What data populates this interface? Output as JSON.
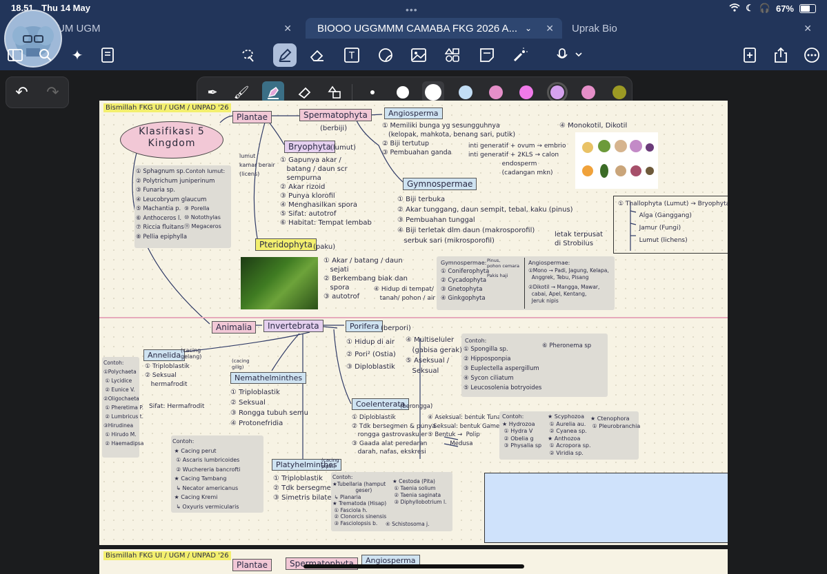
{
  "status": {
    "time": "18.51",
    "date": "Thu 14 May",
    "battery": "67%"
  },
  "tabs": [
    {
      "label": "UM UGM"
    },
    {
      "label": "BIOOO UGGMMM CAMABA FKG 2026 A..."
    },
    {
      "label": "Uprak Bio"
    }
  ],
  "toolbar": {
    "icons": [
      "sidebar-icon",
      "search-icon",
      "sparkle-icon",
      "export-pages-icon",
      "lasso-icon",
      "pen-icon",
      "eraser-icon",
      "textbox-icon",
      "sticker-icon",
      "image-icon",
      "shapes-icon",
      "note-icon",
      "laser-icon",
      "mic-icon",
      "add-page-icon",
      "share-icon",
      "more-icon"
    ]
  },
  "pen_tools": {
    "colors": [
      "#ffffff",
      "#ffffff",
      "#ffffff",
      "#c2ddf5",
      "#e58fc9",
      "#f07ae9",
      "#d6a2ef",
      "#e58fc9",
      "#9c9a24"
    ],
    "selected_color_index": 6
  },
  "note": {
    "header": "Bismillah FKG UI / UGM / UNPAD '26",
    "title": "Klasifikasi 5 Kingdom",
    "plantae": "Plantae",
    "spermatophyta": "Spermatophyta",
    "berbiji": "(berbiji)",
    "angiosperma": "Angiosperma",
    "angio_points": "① Memiliki bunga yg sesungguhnya\n   (kelopak, mahkota, benang sari, putik)\n② Biji tertutup\n③ Pembuahan ganda",
    "angio_fert": "inti generatif + ovum → embrio\ninti generatif + 2KLS → calon\n                 endosperm\n                 (cadangan mkn)",
    "monokotil": "④ Monokotil, Dikotil",
    "lumut_label": "lumut\nkamar berair\n(licens)",
    "bryophyta": "Bryophyta",
    "bryo_lumut": "(lumut)",
    "bryo_points": "① Gapunya akar /\n   batang / daun scr\n   sempurna\n② Akar rizoid\n③ Punya klorofil\n④ Menghasilkan spora\n⑤ Sifat: autotrof\n⑥ Habitat: Tempat lembab",
    "lumut_examples_title": "Contoh lumut:",
    "lumut_examples": "① Sphagnum sp.\n② Polytrichum juniperinum\n③ Funaria sp.\n④ Leucobryum glaucum\n⑤ Machantia p.\n⑥ Anthoceros l.\n⑦ Riccia fluitans\n⑧ Pellia epiphylla",
    "lumut_examples2": "⑨ Porella\n⑩ Notothylas\n⑪ Megaceros",
    "gymnospermae": "Gymnospermae",
    "gymno_points": "① Biji terbuka\n② Akar tunggang, daun sempit, tebal, kaku (pinus)\n③ Pembuahan tunggal\n④ Biji terletak dlm daun (makrosporofil)\n   serbuk sari (mikrosporofil)",
    "strobilus": "letak terpusat\ndi Strobilus",
    "gymno_box_title": "Gymnospermae:",
    "gymno_box": "① Coniferophyta\n② Cycadophyta\n③ Gnetophyta\n④ Ginkgophyta",
    "pinus": "Pinus,\npohon cemara",
    "pakis": "Pakis haji",
    "angio_box_title": "Angiospermae:",
    "angio_box_mono": "①Mono → Padi, Jagung, Kelapa,\n  Anggrek, Tebu, Pisang",
    "angio_box_di": "②Dikotil → Mangga, Mawar,\n  cabai, Apel, Kentang,\n  Jeruk nipis",
    "thallophyta": "① Thallophyta (Lumut) → Bryophyta",
    "thallo_items": "   Alga (Ganggang)\n   Jamur (Fungi)\n   Lumut (lichens)",
    "pteridophyta": "Pteridophyta",
    "paku": "(paku)",
    "pteri_points": "① Akar / batang / daun\n   sejati\n② Berkembang biak dan\n   spora\n③ autotrof",
    "pteri_4": "④ Hidup di tempat/\n   tanah/ pohon / air",
    "animalia": "Animalia",
    "invertebrata": "Invertebrata",
    "porifera": "Porifera",
    "porifera_note": "(berpori)",
    "porifera_points": "① Hidup di air\n② Pori² (Ostia)\n③ Diploblastik",
    "porifera_points2": "④ Multiseluler\n   (gabisa gerak)\n⑤ Aseksual /\n   Seksual",
    "porifera_ex_title": "Contoh:",
    "porifera_ex": "① Spongilla sp.\n② Hipposponpia\n③ Euplectella aspergillum\n④ Sycon ciliatum\n⑤ Leucosolenia botryoides",
    "porifera_ex2": "⑥ Pheronema sp",
    "annelida": "Annelida",
    "annelida_note": "(cacing\ngelang)",
    "annelida_points": "① Triploblastik\n② Seksual\n   hermafrodit",
    "annelida_ex": "Contoh:\n①Polychaeta\n ① Lycidice\n ② Eunice V.\n②Oligochaeta\n ① Pheretima P.\n ② Lumbricus t.\n③Hirudinea\n ① Hirudo M.\n ② Haemadipsa",
    "hermafrodit": "Sifat: Hermafrodit",
    "nemathelminthes": "Nemathelminthes",
    "nemat_note": "(cacing\ngilig)",
    "nemat_points": "① Triploblastik\n② Seksual\n③ Rongga tubuh semu\n④ Protonefridia",
    "nemat_ex": "Contoh:\n ★ Cacing perut\n  ① Ascaris lumbricoides\n  ② Wuchereria bancrofti\n ★ Cacing Tambang\n  ↳ Necator americanus\n ★ Cacing Kremi\n  ↳ Oxyuris vermicularis",
    "coelenterata": "Coelenterata",
    "coel_note": "(berongga)",
    "coel_points": "① Diploblastik\n② Tdk bersegmen & punya\n   rongga gastrovaskuler\n③ Gaada alat peredaran\n   darah, nafas, ekskresi",
    "coel_points2": "④ Aseksual: bentuk Tunas\n   Seksual: bentuk Gamet\n⑤ Bentuk →  Polip\n            Medusa",
    "coel_ex": "Contoh:\n★ Hydrozoa\n ① Hydra V\n ② Obelia g\n ③ Physalia sp",
    "coel_ex2": "★ Scyphozoa\n ① Aurelia au.\n ② Cyanea sp.\n★ Anthozoa\n ① Acropora sp.\n ② Viridia sp.",
    "coel_ex3": "★ Ctenophora\n ① Pleurobranchia",
    "platyhelminthes": "Platyhelminthes",
    "platy_note": "(cacing\npipih)",
    "platy_points": "① Triploblastik\n② Tdk bersegmen\n③ Simetris bilateral",
    "platy_ex": "Contoh:\n★Tubellaria (hamput\n              geser)\n ↳ Planaria\n★ Trematoda (Hisap)\n ① Fasciola h.\n ② Clonorcis sinensis\n ③ Fasciolopsis b.",
    "platy_ex2": "★ Cestoda (Pita)\n ① Taenia solium\n ② Taenia saginata\n ③ Diphyllobotrium l.",
    "schistosoma": "④ Schistosoma j."
  }
}
